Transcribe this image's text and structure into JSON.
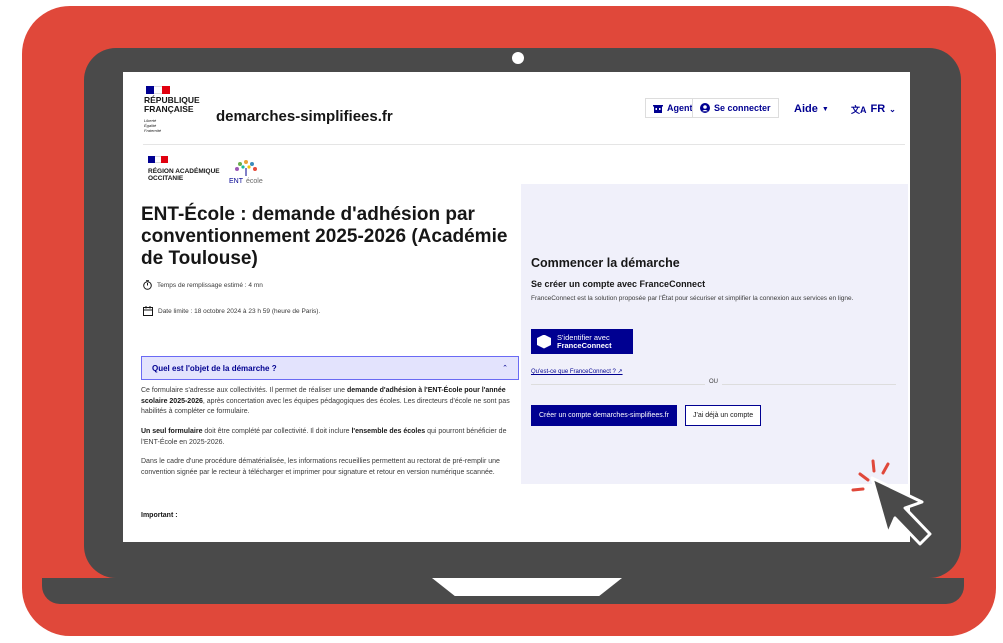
{
  "header": {
    "republic_lines": "RÉPUBLIQUE\nFRANÇAISE",
    "motto": "Liberté\nÉgalité\nFraternité",
    "site_name": "demarches-simplifiees.fr",
    "agent_label": "Agent",
    "login_label": "Se connecter",
    "help_label": "Aide",
    "lang_label": "FR"
  },
  "org": {
    "name_lines": "RÉGION ACADÉMIQUE\nOCCITANIE",
    "ent_label": "ENT",
    "ent_sub": "école"
  },
  "main": {
    "title": "ENT-École : demande d'adhésion par conventionnement 2025-2026 (Académie de Toulouse)",
    "duration": "Temps de remplissage estimé : 4 mn",
    "deadline": "Date limite : 18 octobre 2024 à 23 h 59 (heure de Paris).",
    "accordion_label": "Quel est l'objet de la démarche ?",
    "p1_a": "Ce formulaire s'adresse aux collectivités. Il permet de réaliser une ",
    "p1_b": "demande d'adhésion à l'ENT-École pour l'année scolaire 2025-2026",
    "p1_c": ", après concertation avec les équipes pédagogiques des écoles. Les directeurs d'école ne sont pas habilités à compléter ce formulaire.",
    "p2_a": "Un seul formulaire",
    "p2_b": " doit être complété par collectivité. Il doit inclure ",
    "p2_c": "l'ensemble des écoles",
    "p2_d": " qui pourront bénéficier de l'ENT-École en 2025-2026.",
    "p3": "Dans le cadre d'une procédure dématérialisée, les informations recueillies permettent au rectorat de pré-remplir une convention signée par le recteur à télécharger et imprimer pour signature et retour en version numérique scannée.",
    "important": "Important :"
  },
  "panel": {
    "heading": "Commencer la démarche",
    "sub": "Se créer un compte avec FranceConnect",
    "text": "FranceConnect est la solution proposée par l'État pour sécuriser et simplifier la connexion aux services en ligne.",
    "fc_line1": "S'identifier avec",
    "fc_line2": "FranceConnect",
    "fc_link": "Qu'est-ce que FranceConnect ? ↗",
    "or": "OU",
    "create_account": "Créer un compte demarches-simplifiees.fr",
    "have_account": "J'ai déjà un compte"
  },
  "colors": {
    "background": "#e0483a",
    "laptop": "#4a4a4a",
    "primary_blue": "#000091",
    "marianne_red": "#e1000f",
    "panel_bg": "#f0f0fa"
  },
  "icons": [
    "building-icon",
    "user-circle-icon",
    "chevron-down-icon",
    "translate-icon",
    "timer-icon",
    "calendar-icon",
    "chevron-up-icon",
    "franceconnect-logo",
    "external-link-icon",
    "cursor-arrow-icon"
  ]
}
